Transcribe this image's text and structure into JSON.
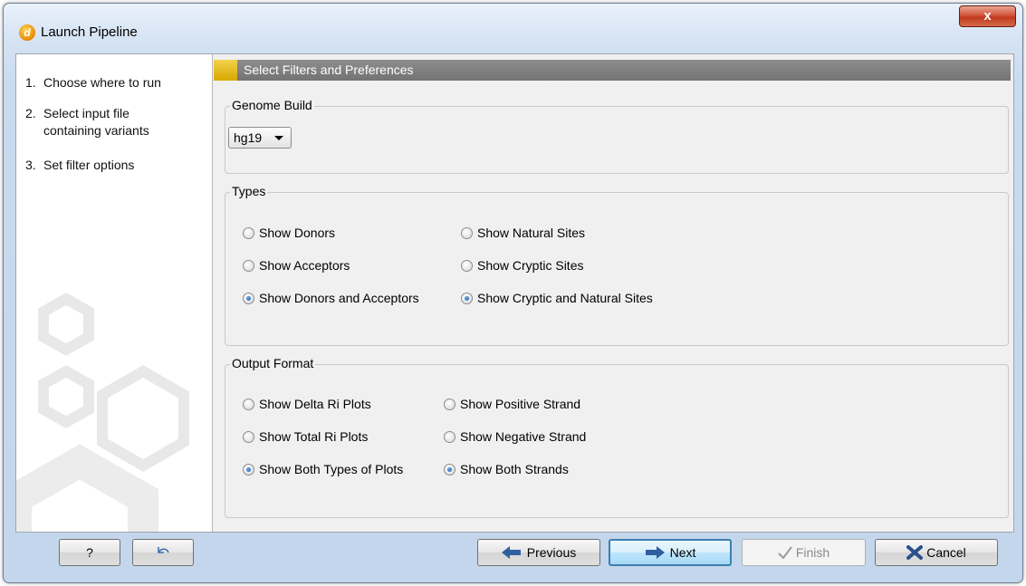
{
  "window": {
    "title": "Launch Pipeline",
    "app_icon_letter": "d",
    "close_glyph": "x"
  },
  "steps": [
    {
      "number": "1.",
      "label": "Choose where to run"
    },
    {
      "number": "2.",
      "label": "Select input file containing variants",
      "line1": "Select input file",
      "line2": "containing variants"
    },
    {
      "number": "3.",
      "label": "Set filter options"
    }
  ],
  "panel": {
    "header": "Select Filters and Preferences"
  },
  "genome_build": {
    "title": "Genome Build",
    "selected": "hg19"
  },
  "types": {
    "title": "Types",
    "options": [
      {
        "label": "Show Donors",
        "checked": false
      },
      {
        "label": "Show Acceptors",
        "checked": false
      },
      {
        "label": "Show Donors and Acceptors",
        "checked": true
      },
      {
        "label": "Show Natural Sites",
        "checked": false
      },
      {
        "label": "Show Cryptic Sites",
        "checked": false
      },
      {
        "label": "Show Cryptic and Natural Sites",
        "checked": true
      }
    ]
  },
  "output_format": {
    "title": "Output Format",
    "options": [
      {
        "label": "Show Delta Ri Plots",
        "checked": false
      },
      {
        "label": "Show Total Ri Plots",
        "checked": false
      },
      {
        "label": "Show Both Types of Plots",
        "checked": true
      },
      {
        "label": "Show Positive Strand",
        "checked": false
      },
      {
        "label": "Show Negative Strand",
        "checked": false
      },
      {
        "label": "Show Both Strands",
        "checked": true
      }
    ]
  },
  "buttons": {
    "help": "?",
    "reset_icon": "undo-arrow-icon",
    "previous": "Previous",
    "next": "Next",
    "finish": "Finish",
    "cancel": "Cancel"
  }
}
